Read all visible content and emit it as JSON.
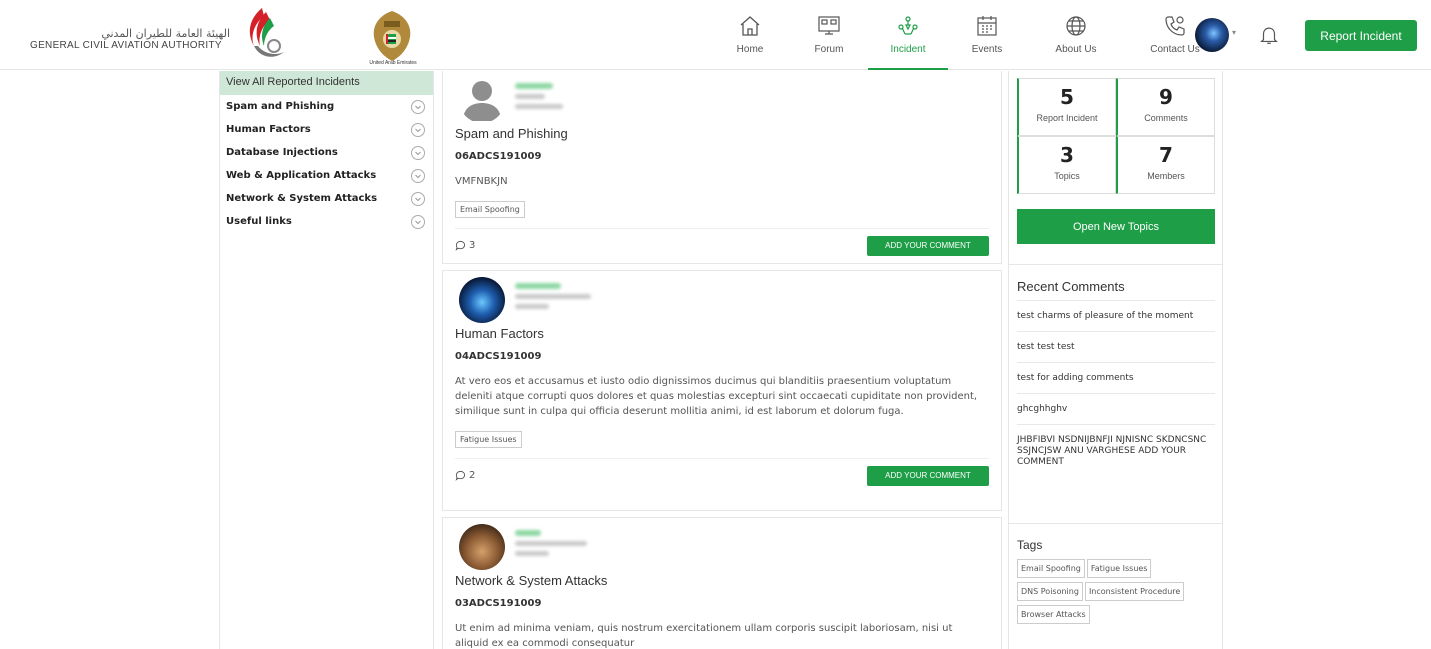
{
  "header": {
    "logo_arabic": "الهيئة العامة للطيران المدني",
    "logo_english": "GENERAL CIVIL AVIATION AUTHORITY",
    "emblem_caption": "United Arab Emirates",
    "nav": [
      {
        "label": "Home",
        "icon": "home-icon"
      },
      {
        "label": "Forum",
        "icon": "forum-icon"
      },
      {
        "label": "Incident",
        "icon": "incident-icon"
      },
      {
        "label": "Events",
        "icon": "calendar-icon"
      },
      {
        "label": "About Us",
        "icon": "globe-icon"
      },
      {
        "label": "Contact Us",
        "icon": "phone-icon"
      }
    ],
    "active_nav": "Incident",
    "report_button": "Report Incident"
  },
  "sidebar": {
    "header": "View All Reported Incidents",
    "items": [
      "Spam and Phishing",
      "Human Factors",
      "Database Injections",
      "Web & Application Attacks",
      "Network & System Attacks",
      "Useful links"
    ]
  },
  "feed": {
    "posts": [
      {
        "category": "Spam and Phishing",
        "code": "06ADCS191009",
        "body": "VMFNBKJN",
        "tag": "Email Spoofing",
        "comments": "3",
        "button": "ADD YOUR COMMENT"
      },
      {
        "category": "Human Factors",
        "code": "04ADCS191009",
        "body": "At vero eos et accusamus et iusto odio dignissimos ducimus qui blanditiis praesentium voluptatum deleniti atque corrupti quos dolores et quas molestias excepturi sint occaecati cupiditate non provident, similique sunt in culpa qui officia deserunt mollitia animi, id est laborum et dolorum fuga.",
        "tag": "Fatigue Issues",
        "comments": "2",
        "button": "ADD YOUR COMMENT"
      },
      {
        "category": "Network & System Attacks",
        "code": "03ADCS191009",
        "body": "Ut enim ad minima veniam, quis nostrum exercitationem ullam corporis suscipit laboriosam, nisi ut aliquid ex ea commodi consequatur"
      }
    ]
  },
  "stats": [
    {
      "value": "5",
      "label": "Report Incident"
    },
    {
      "value": "9",
      "label": "Comments"
    },
    {
      "value": "3",
      "label": "Topics"
    },
    {
      "value": "7",
      "label": "Members"
    }
  ],
  "open_topics_button": "Open New Topics",
  "recent_comments": {
    "title": "Recent Comments",
    "items": [
      "test charms of pleasure of the moment",
      "test test test",
      "test for adding comments",
      "ghcghhghv",
      "JHBFIBVI NSDNIJBNFJI NJNISNC SKDNCSNC SSJNCJSW ANU VARGHESE ADD YOUR COMMENT"
    ]
  },
  "tags": {
    "title": "Tags",
    "items": [
      "Email Spoofing",
      "Fatigue Issues",
      "DNS Poisoning",
      "Inconsistent Procedure",
      "Browser Attacks"
    ]
  },
  "colors": {
    "accent": "#1e9e47",
    "sidebar_header": "#cfe7d6"
  }
}
